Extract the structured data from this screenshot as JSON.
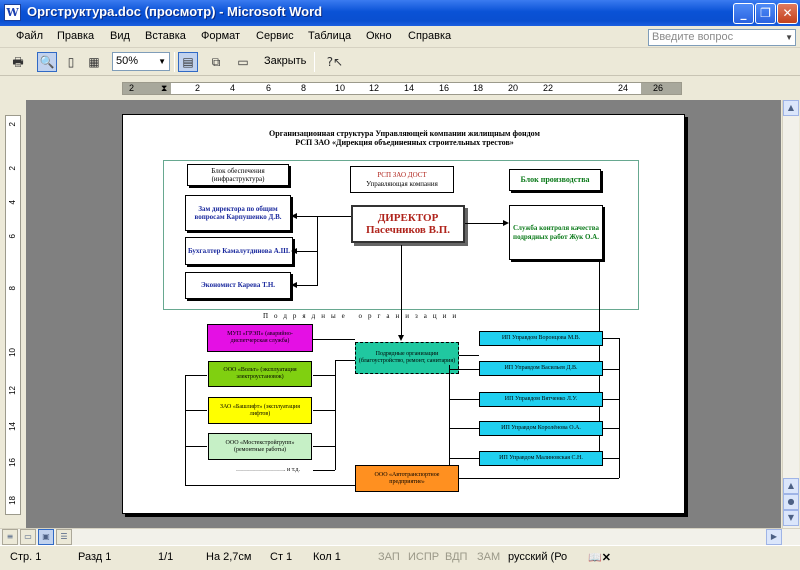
{
  "window": {
    "title": "Оргструктура.doc (просмотр) - Microsoft Word",
    "app_icon": "W"
  },
  "menu": {
    "items": [
      "Файл",
      "Правка",
      "Вид",
      "Вставка",
      "Формат",
      "Сервис",
      "Таблица",
      "Окно",
      "Справка"
    ],
    "ask_placeholder": "Введите вопрос"
  },
  "toolbar": {
    "zoom": "50%",
    "close_label": "Закрыть"
  },
  "ruler": {
    "h_numbers": [
      "2",
      "2",
      "4",
      "6",
      "8",
      "10",
      "12",
      "14",
      "16",
      "18",
      "20",
      "22",
      "24",
      "26"
    ],
    "v_numbers": [
      "2",
      "2",
      "4",
      "6",
      "8",
      "10",
      "12",
      "14",
      "16",
      "18"
    ]
  },
  "diagram": {
    "title_line1": "Организационная структура Управляющей компании жилищным фондом",
    "title_line2": "РСП ЗАО «Дирекция объединенных строительных трестов»",
    "supply_block": "Блок обеспечения (инфраструктура)",
    "rsp_title": "РСП ЗАО ДОСТ",
    "rsp_sub": "Управляющая компания",
    "production_block": "Блок производства",
    "deputy": "Зам директора по общим вопросам Карпушенко Д.В.",
    "director_title": "ДИРЕКТОР",
    "director_name": "Пасечников В.П.",
    "quality": "Служба контроля качества подрядных работ Жук О.А.",
    "accountant": "Бухгалтер Камалутдинова А.Ш.",
    "economist": "Экономист Карева Т.Н.",
    "contractors_label": "Подрядные организации",
    "mup": "МУП «ГРЭП» (аварийно-диспетчерская служба)",
    "volt": "ООО «Вольт» (эксплуатация электроустановок)",
    "lift": "ЗАО «Башлифт» (эксплуатация лифтов)",
    "mostek": "ООО «Мостекстройгрупп» (ремонтные работы)",
    "etc": "……………………. и т.д.",
    "subcontractors": "Подрядные организации (благоустройство, ремонт, санитария)",
    "ip1": "ИП Управдом Воронцова М.В.",
    "ip2": "ИП Управдом Васильев Д.В.",
    "ip3": "ИП Управдом Вятченко Л.У.",
    "ip4": "ИП Управдом Королёнова О.А.",
    "ip5": "ИП Управдом Малиновская С.Н.",
    "autotransport": "ООО «Автотранспортное предприятие»"
  },
  "status": {
    "page": "Стр. 1",
    "section": "Разд 1",
    "pages": "1/1",
    "at": "На 2,7см",
    "line": "Ст 1",
    "col": "Кол 1",
    "rec": "ЗАП",
    "trk": "ИСПР",
    "ext": "ВДП",
    "ovr": "ЗАМ",
    "lang": "русский (Ро"
  },
  "colors": {
    "title_bar": "#0a52d6",
    "director_text": "#b0241c",
    "deputy_text": "#1b2a9e",
    "production_text": "#0b7a1a",
    "mup_fill": "#e410e4",
    "volt_fill": "#80d010",
    "lift_fill": "#ffff00",
    "mostek_fill": "#c6f0c6",
    "subcontractors_fill": "#20c8a0",
    "ip_fill": "#20d0f0",
    "autotransport_fill": "#ff9020"
  }
}
